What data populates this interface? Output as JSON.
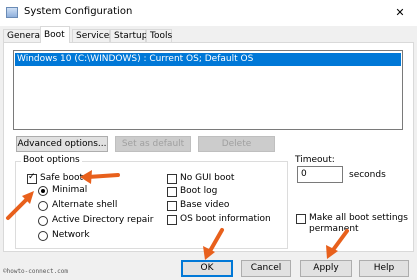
{
  "window": {
    "title": "System Configuration",
    "close_glyph": "✕"
  },
  "tabs": [
    "General",
    "Boot",
    "Services",
    "Startup",
    "Tools"
  ],
  "active_tab": "Boot",
  "os_list": [
    "Windows 10 (C:\\WINDOWS) : Current OS; Default OS"
  ],
  "buttons": {
    "advanced": "Advanced options...",
    "set_default": "Set as default",
    "delete": "Delete"
  },
  "boot_options": {
    "legend": "Boot options",
    "safe_boot": "Safe boot",
    "minimal": "Minimal",
    "alternate_shell": "Alternate shell",
    "ad_repair": "Active Directory repair",
    "network": "Network",
    "no_gui": "No GUI boot",
    "boot_log": "Boot log",
    "base_video": "Base video",
    "os_info": "OS boot information"
  },
  "timeout": {
    "label": "Timeout:",
    "value": "0",
    "unit": "seconds"
  },
  "permanent": {
    "line1": "Make all boot settings",
    "line2": "permanent"
  },
  "dialog_buttons": {
    "ok": "OK",
    "cancel": "Cancel",
    "apply": "Apply",
    "help": "Help"
  },
  "watermark": "©howto-connect.com",
  "colors": {
    "selection": "#0078d7",
    "annotation_arrow": "#e8601c"
  }
}
